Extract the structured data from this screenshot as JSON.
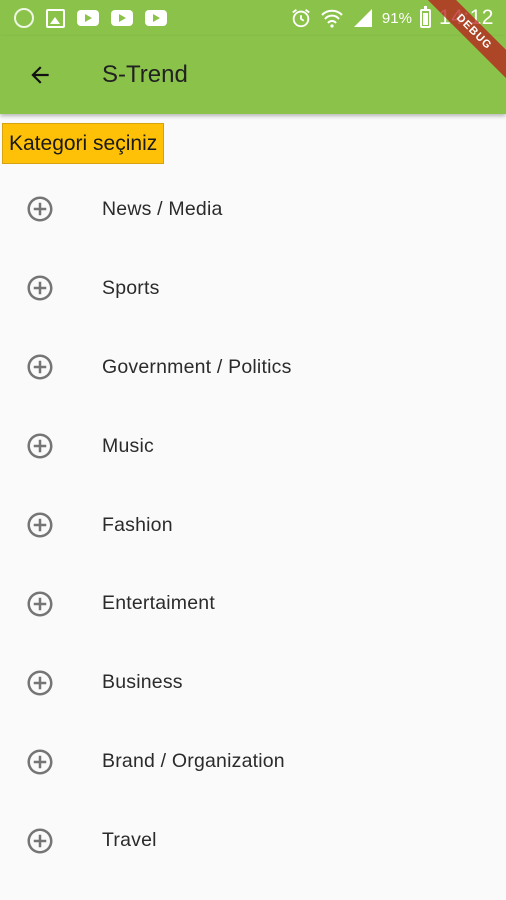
{
  "status_bar": {
    "battery": "91%",
    "time": "14:12"
  },
  "app_bar": {
    "title": "S-Trend"
  },
  "debug_banner": "DEBUG",
  "category_header": "Kategori seçiniz",
  "categories": [
    {
      "label": "News / Media"
    },
    {
      "label": "Sports"
    },
    {
      "label": "Government / Politics"
    },
    {
      "label": "Music"
    },
    {
      "label": "Fashion"
    },
    {
      "label": "Entertaiment"
    },
    {
      "label": "Business"
    },
    {
      "label": "Brand / Organization"
    },
    {
      "label": "Travel"
    }
  ],
  "colors": {
    "app_bar": "#8bc34a",
    "header_badge": "#ffc107",
    "icon": "#757575"
  }
}
